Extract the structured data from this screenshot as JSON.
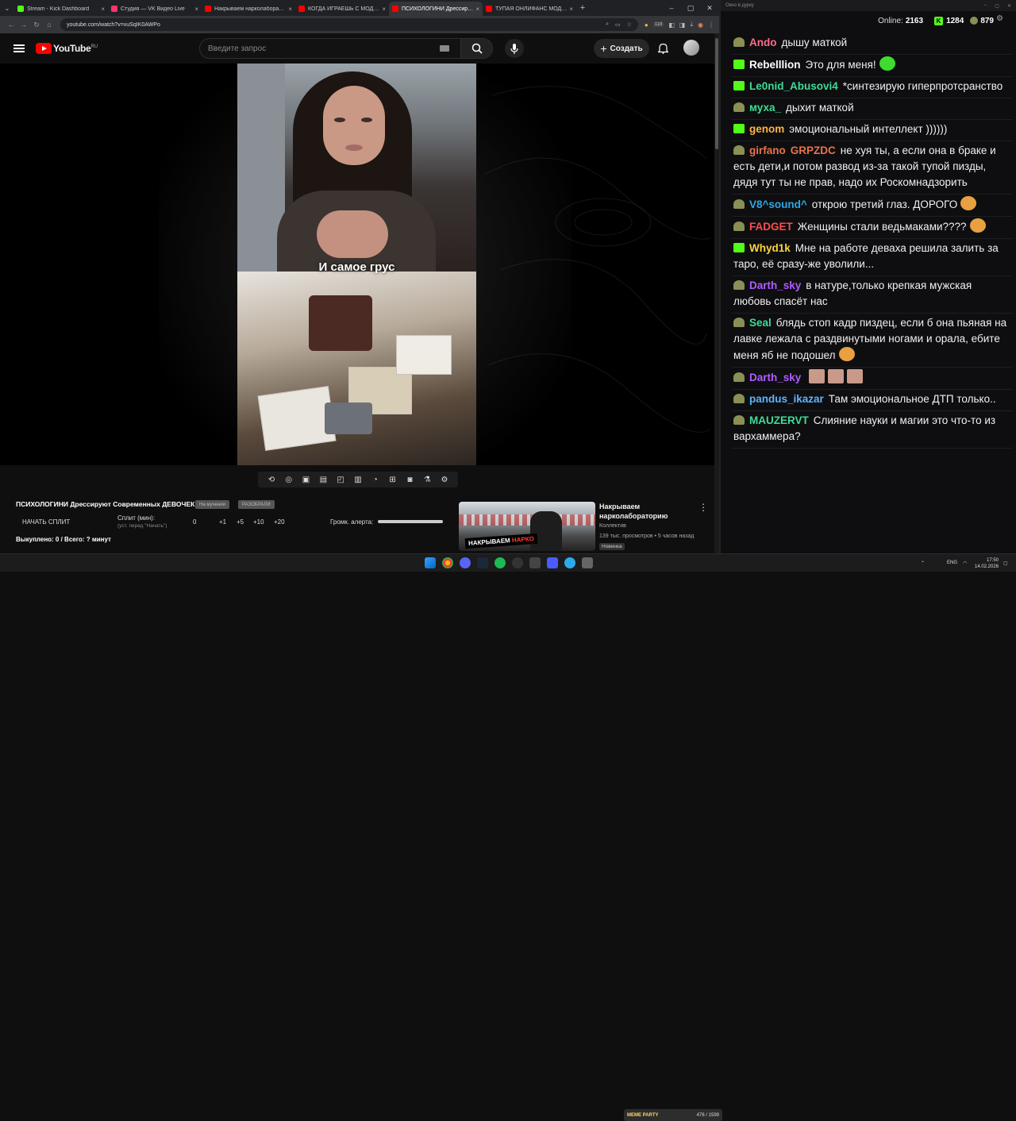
{
  "tabs": [
    {
      "label": "Stream - Kick Dashboard",
      "color": "#53fc18",
      "active": false
    },
    {
      "label": "Студия — VK Видео Live",
      "color": "#ff3366",
      "active": false
    },
    {
      "label": "Накрываем нарколаборатори...",
      "color": "#ff0000",
      "active": false
    },
    {
      "label": "КОГДА ИГРАЕШЬ С МОДАМИ...",
      "color": "#ff0000",
      "active": false
    },
    {
      "label": "ПСИХОЛОГИНИ Дрессирую...",
      "color": "#ff0000",
      "active": true
    },
    {
      "label": "ТУПАЯ ОНЛИФАНС МОДЕЛЬ...",
      "color": "#ff0000",
      "active": false
    }
  ],
  "url": "youtube.com/watch?v=vuSqIK0AWPo",
  "ext_badge": "118",
  "yt": {
    "brand": "YouTube",
    "region": "RU",
    "search_placeholder": "Введите запрос",
    "create_label": "Создать"
  },
  "video": {
    "caption": "И самое грус"
  },
  "overlay": {
    "title": "ПСИХОЛОГИНИ Дрессируют Современных ДЕВОЧЕК",
    "tag1": "На мучении",
    "tag2": "РАЗОБРАЛИ",
    "start_split": "НАЧАТЬ СПЛИТ",
    "split_label": "Сплит (мин):",
    "split_hint": "(уст. перед \"Начать\")",
    "split_value": "0",
    "inc": [
      "+1",
      "+5",
      "+10",
      "+20"
    ],
    "volume_label": "Громк. алерта:",
    "bought": "Выкуплено: 0 / Всего: ? минут"
  },
  "recommended": {
    "thumb_text_1": "НАКРЫВАЕМ",
    "thumb_text_2": "НАРКО",
    "title": "Накрываем нарколабораторию",
    "channel": "Коллектив",
    "meta": "139 тыс. просмотров • 5 часов назад",
    "badge": "Новинка"
  },
  "chat": {
    "window_title": "Окно в дурку",
    "online_label": "Online:",
    "online": "2163",
    "kick_count": "1284",
    "vk_count": "879",
    "messages": [
      {
        "name": "Ando",
        "color": "#ff6b8a",
        "badge": "g",
        "text": "дышу маткой"
      },
      {
        "name": "Rebelllion",
        "color": "#ffffff",
        "badge": "k",
        "text": "Это для меня!"
      },
      {
        "name": "Le0nid_Abusovi4",
        "color": "#3ddc97",
        "badge": "k",
        "text": "*синтезирую гиперпротсранство"
      },
      {
        "name": "муха_",
        "color": "#3ddc97",
        "badge": "g",
        "text": "дыхит маткой"
      },
      {
        "name": "genom",
        "color": "#ffb347",
        "badge": "k",
        "text": "эмоциональный интеллект ))))))"
      },
      {
        "name": "girfano",
        "color": "#e8734a",
        "name2": "GRPZDC",
        "badge": "g",
        "text": "не хуя ты, а если она в браке и есть дети,и потом развод из-за такой тупой пизды, дядя тут ты не прав, надо их Роскомнадзорить"
      },
      {
        "name": "V8^sound^",
        "color": "#2ea8e6",
        "badge": "g",
        "text": "открою третий глаз. ДОРОГО"
      },
      {
        "name": "FADGET",
        "color": "#ff4d4d",
        "badge": "g",
        "text": "Женщины стали ведьмаками????"
      },
      {
        "name": "Whyd1k",
        "color": "#ffd23f",
        "badge": "k",
        "text": "Мне на работе деваха решила залить за таро, её сразу-же уволили..."
      },
      {
        "name": "Darth_sky",
        "color": "#b15cff",
        "badge": "g",
        "text": "в натуре,только крепкая мужская любовь спасёт нас"
      },
      {
        "name": "Seal",
        "color": "#3ddc97",
        "badge": "g",
        "text": "блядь стоп кадр пиздец, если б она пьяная на лавке лежала с раздвинутыми ногами и орала, ебите меня яб не подошел"
      },
      {
        "name": "Darth_sky",
        "color": "#b15cff",
        "badge": "g",
        "text": ""
      },
      {
        "name": "pandus_ikazar",
        "color": "#5fb3ff",
        "badge": "g",
        "text": "Там эмоциональное ДТП только.."
      },
      {
        "name": "MAUZERVT",
        "color": "#3ddc97",
        "badge": "g",
        "text": "Слияние науки и магии это что-то из вархаммера?"
      }
    ]
  },
  "taskbar": {
    "music": "MEME PARTY",
    "music_progress": "476 / 1599",
    "lang": "ENG",
    "time": "17:50",
    "date": "14.02.2026"
  }
}
